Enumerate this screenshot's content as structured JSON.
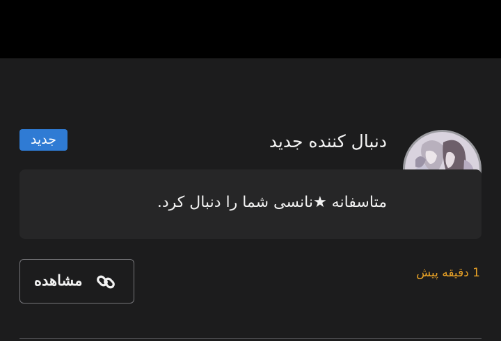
{
  "notification": {
    "title": "دنبال کننده جدید",
    "badge": "جدید",
    "message": "متاسفانه ★نانسی شما را دنبال کرد.",
    "time": "1 دقیقه پیش",
    "view_label": "مشاهده",
    "view_icon": "link-icon",
    "avatar": "user-avatar"
  },
  "colors": {
    "background": "#1c1c1d",
    "badge": "#2f7bd4",
    "time": "#e7a126",
    "message_box": "#262627"
  }
}
